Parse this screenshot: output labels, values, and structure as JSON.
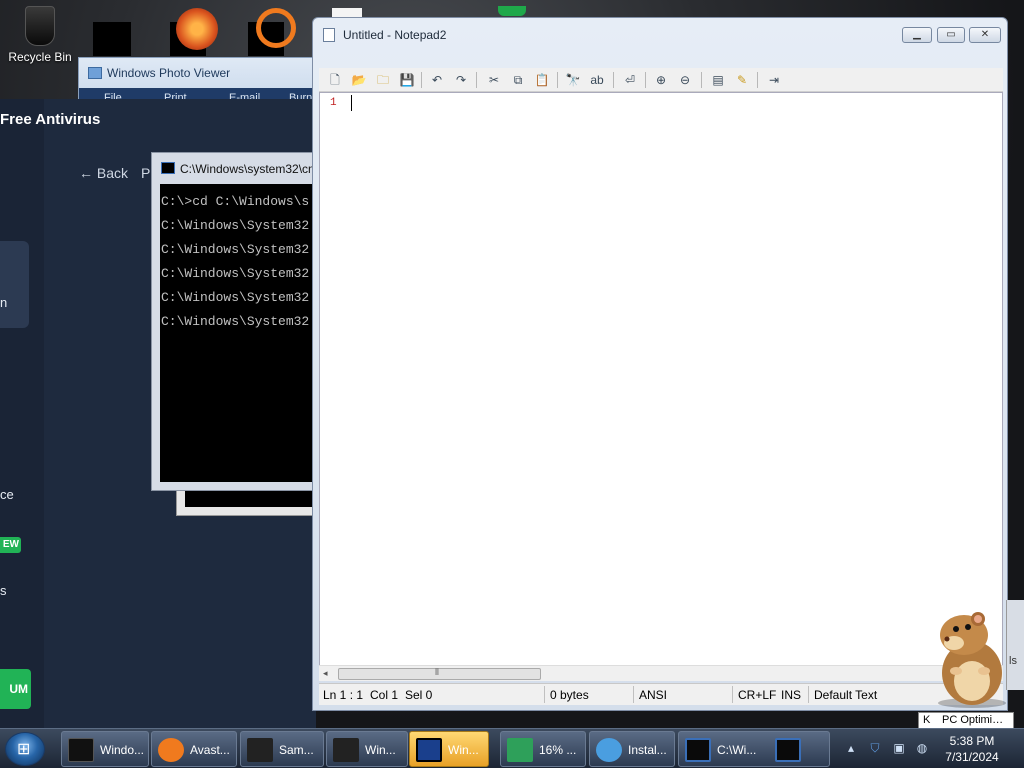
{
  "desktop": {
    "icons": [
      {
        "label": "Recycle Bin"
      }
    ]
  },
  "photo_viewer": {
    "title": "Windows Photo Viewer",
    "menu": [
      "File",
      "Print",
      "E-mail",
      "Burn"
    ]
  },
  "antivirus": {
    "title": "Free Antivirus",
    "back_label": "← Back",
    "p_label": "P",
    "side_labels": [
      "n",
      "ce",
      "s"
    ],
    "new_badge": "EW",
    "premium_label": "UM"
  },
  "cmd": {
    "title": "C:\\Windows\\system32\\cmd.exe",
    "lines": [
      "C:\\>cd C:\\Windows\\s",
      "C:\\Windows\\System32",
      "C:\\Windows\\System32",
      "C:\\Windows\\System32",
      "C:\\Windows\\System32",
      "C:\\Windows\\System32"
    ]
  },
  "notepad": {
    "title": "Untitled - Notepad2",
    "line_number": "1",
    "status": {
      "position": "Ln 1 : 1",
      "col": "Col 1",
      "sel": "Sel 0",
      "size": "0 bytes",
      "encoding": "ANSI",
      "eol": "CR+LF",
      "mode": "INS",
      "scheme": "Default Text"
    },
    "toolbar_icons": [
      "new-file-icon",
      "open-icon",
      "browse-icon",
      "save-icon",
      "undo-icon",
      "redo-icon",
      "cut-icon",
      "copy-icon",
      "paste-icon",
      "find-icon",
      "replace-icon",
      "word-wrap-icon",
      "zoom-in-icon",
      "zoom-out-icon",
      "scheme-icon",
      "customize-icon",
      "exit-icon"
    ]
  },
  "right_edge_label": "ls",
  "tooltip": {
    "key": "K",
    "text": "PC Optimi…"
  },
  "taskbar": {
    "tasks": [
      {
        "label": "Windo...",
        "color": "#111111"
      },
      {
        "label": "Avast...",
        "color": "#f07a1e"
      },
      {
        "label": "Sam...",
        "color": "#222222"
      },
      {
        "label": "Win...",
        "color": "#222222"
      },
      {
        "label": "Win...",
        "color": "#1a3f8c",
        "active": true
      },
      {
        "label": "16% ...",
        "color": "#2ea05a"
      },
      {
        "label": "Instal...",
        "color": "#4a9ee0"
      },
      {
        "label": "C:\\Wi...",
        "color": "#0a0a0a"
      },
      {
        "label": "",
        "color": "#0a0a0a"
      }
    ],
    "clock_time": "5:38 PM",
    "clock_date": "7/31/2024",
    "accent": "#e8a127"
  }
}
